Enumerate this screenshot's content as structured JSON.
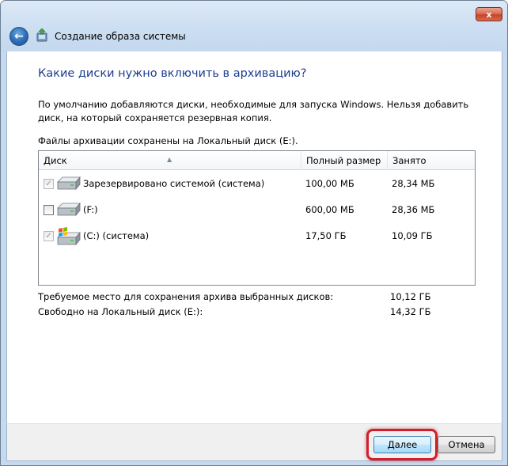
{
  "window": {
    "close_label": "x",
    "title": "Создание образа системы"
  },
  "main": {
    "heading": "Какие диски нужно включить в архивацию?",
    "description": "По умолчанию добавляются диски, необходимые для запуска Windows. Нельзя добавить диск, на который сохраняется резервная копия.",
    "files_label": "Файлы архивации сохранены на Локальный диск (E:)."
  },
  "disk_list": {
    "columns": [
      "Диск",
      "Полный размер",
      "Занято"
    ],
    "rows": [
      {
        "name": "Зарезервировано системой (система)",
        "size": "100,00 МБ",
        "used": "28,34 МБ",
        "checked": true,
        "enabled": false,
        "icon": "hard-drive-icon"
      },
      {
        "name": "(F:)",
        "size": "600,00 МБ",
        "used": "28,36 МБ",
        "checked": false,
        "enabled": true,
        "icon": "hard-drive-icon"
      },
      {
        "name": "(C:) (система)",
        "size": "17,50 ГБ",
        "used": "10,09 ГБ",
        "checked": true,
        "enabled": false,
        "icon": "windows-drive-icon"
      }
    ]
  },
  "summary": {
    "required_label": "Требуемое место для сохранения архива выбранных дисков:",
    "required_value": "10,12 ГБ",
    "free_label": "Свободно на Локальный диск (E:):",
    "free_value": "14,32 ГБ"
  },
  "buttons": {
    "next_prefix": "Д",
    "next_rest": "алее",
    "cancel_label": "Отмена"
  },
  "colors": {
    "heading": "#1e3d8f",
    "highlight": "#d41e2a"
  }
}
